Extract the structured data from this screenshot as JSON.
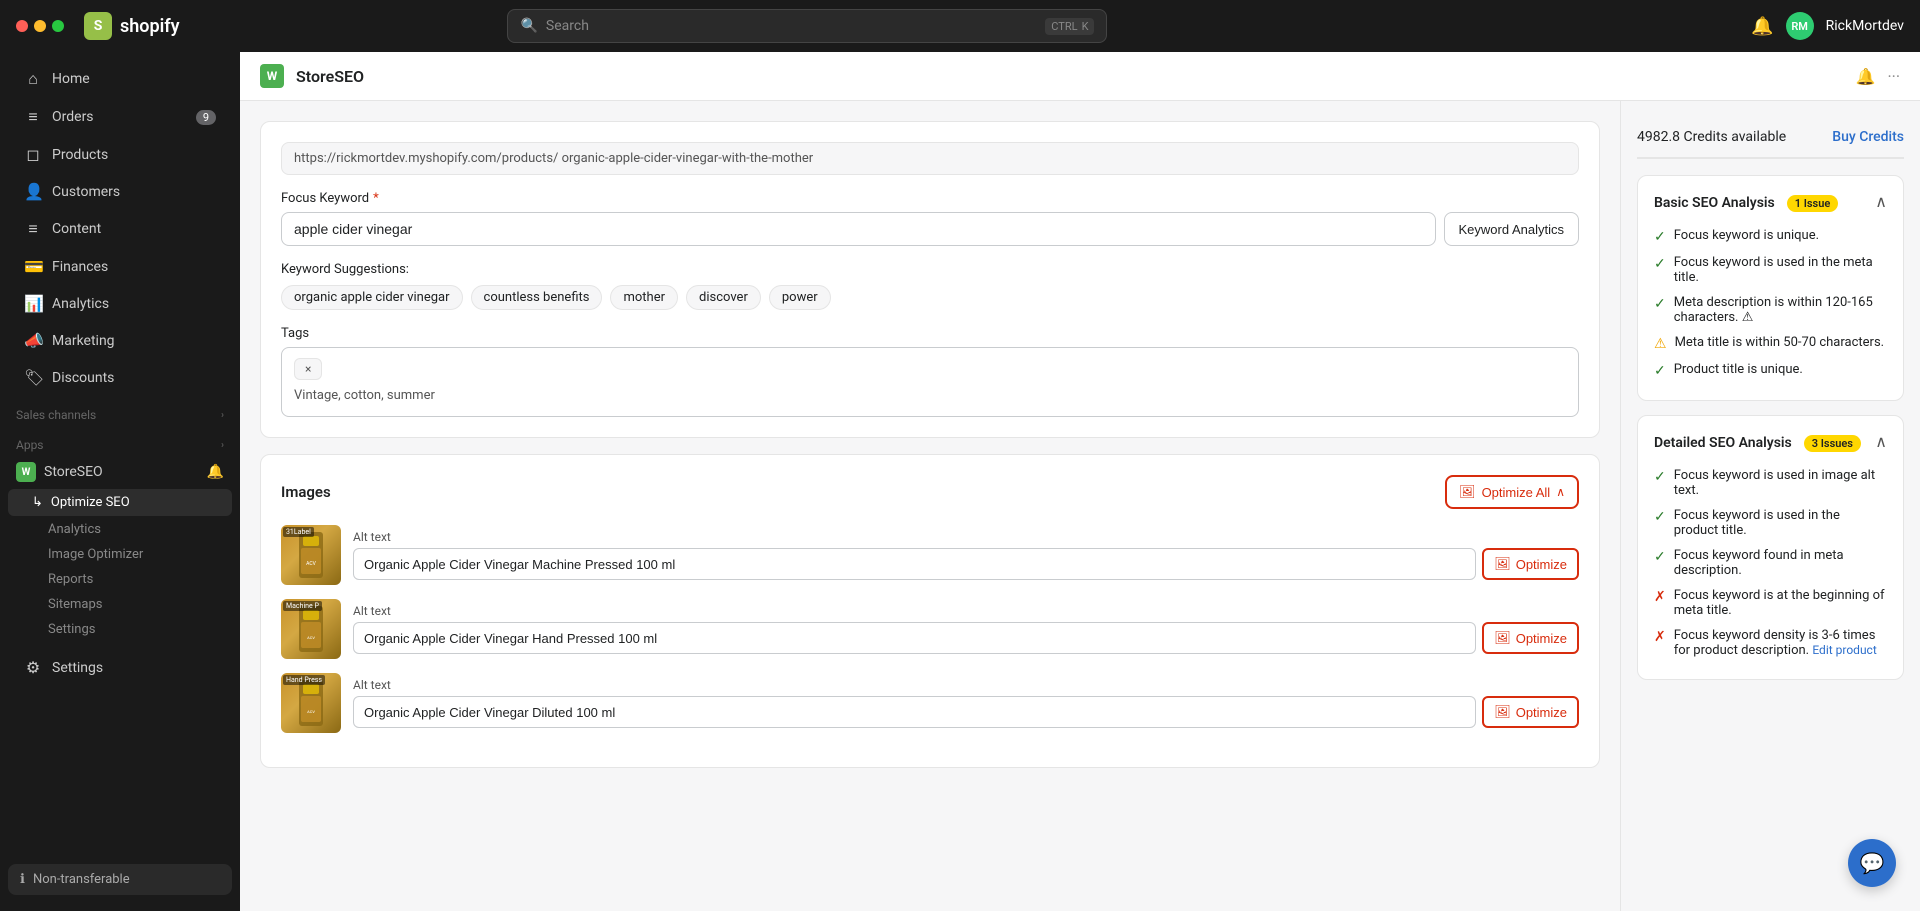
{
  "window": {
    "traffic_lights": [
      "red",
      "yellow",
      "green"
    ]
  },
  "topbar": {
    "brand": "shopify",
    "search_placeholder": "Search",
    "shortcut_ctrl": "CTRL",
    "shortcut_key": "K",
    "username": "RickMortdev"
  },
  "sidebar": {
    "items": [
      {
        "id": "home",
        "label": "Home",
        "icon": "⌂",
        "badge": null
      },
      {
        "id": "orders",
        "label": "Orders",
        "icon": "☰",
        "badge": "9"
      },
      {
        "id": "products",
        "label": "Products",
        "icon": "◫",
        "badge": null
      },
      {
        "id": "customers",
        "label": "Customers",
        "icon": "👤",
        "badge": null
      },
      {
        "id": "content",
        "label": "Content",
        "icon": "☰",
        "badge": null
      },
      {
        "id": "finances",
        "label": "Finances",
        "icon": "💰",
        "badge": null
      },
      {
        "id": "analytics",
        "label": "Analytics",
        "icon": "📊",
        "badge": null
      },
      {
        "id": "marketing",
        "label": "Marketing",
        "icon": "📣",
        "badge": null
      },
      {
        "id": "discounts",
        "label": "Discounts",
        "icon": "🏷",
        "badge": null
      }
    ],
    "sales_channels": "Sales channels",
    "apps_label": "Apps",
    "storeseo": {
      "label": "StoreSEO",
      "sub_items": [
        {
          "id": "optimize-seo",
          "label": "Optimize SEO",
          "active": true
        },
        {
          "id": "analytics-sub",
          "label": "Analytics"
        },
        {
          "id": "image-optimizer",
          "label": "Image Optimizer"
        },
        {
          "id": "reports",
          "label": "Reports"
        },
        {
          "id": "sitemaps",
          "label": "Sitemaps"
        },
        {
          "id": "settings-sub",
          "label": "Settings"
        }
      ]
    },
    "settings_label": "Settings",
    "non_transferable": "Non-transferable"
  },
  "app_header": {
    "title": "StoreSEO",
    "bell_icon": "🔔",
    "more_icon": "···"
  },
  "main": {
    "url_bar": "https://rickmortdev.myshopify.com/products/  organic-apple-cider-vinegar-with-the-mother",
    "focus_keyword": {
      "label": "Focus Keyword",
      "value": "apple cider vinegar",
      "keyword_analytics_btn": "Keyword Analytics"
    },
    "suggestions": {
      "label": "Keyword Suggestions:",
      "tags": [
        "organic apple cider vinegar",
        "countless benefits",
        "mother",
        "discover",
        "power"
      ]
    },
    "tags": {
      "label": "Tags",
      "tag_chip": "×",
      "tag_value": "Vintage, cotton, summer"
    },
    "images": {
      "title": "Images",
      "optimize_all_btn": "Optimize All",
      "rows": [
        {
          "alt_label": "Alt text",
          "alt_value": "Organic Apple Cider Vinegar Machine Pressed 100 ml",
          "thumb_label": "31Label",
          "optimize_btn": "Optimize"
        },
        {
          "alt_label": "Alt text",
          "alt_value": "Organic Apple Cider Vinegar Hand Pressed 100 ml",
          "thumb_label": "Machine P",
          "optimize_btn": "Optimize"
        },
        {
          "alt_label": "Alt text",
          "alt_value": "Organic Apple Cider Vinegar Diluted 100 ml",
          "thumb_label": "Hand Press",
          "optimize_btn": "Optimize"
        }
      ]
    }
  },
  "right_panel": {
    "credits": {
      "available": "4982.8 Credits available",
      "buy_btn": "Buy Credits"
    },
    "basic_seo": {
      "title": "Basic SEO Analysis",
      "badge": "1 Issue",
      "items": [
        {
          "status": "check",
          "text": "Focus keyword is unique."
        },
        {
          "status": "check",
          "text": "Focus keyword is used in the meta title."
        },
        {
          "status": "check",
          "text": "Meta description is within 120-165 characters. ⚠"
        },
        {
          "status": "warn",
          "text": "Meta title is within 50-70 characters."
        },
        {
          "status": "check",
          "text": "Product title is unique."
        }
      ]
    },
    "detailed_seo": {
      "title": "Detailed SEO Analysis",
      "badge": "3 Issues",
      "items": [
        {
          "status": "check",
          "text": "Focus keyword is used in image alt text."
        },
        {
          "status": "check",
          "text": "Focus keyword is used in the product title."
        },
        {
          "status": "check",
          "text": "Focus keyword found in meta description."
        },
        {
          "status": "cross",
          "text": "Focus keyword is at the beginning of meta title."
        },
        {
          "status": "cross",
          "text": "Focus keyword density is 3-6 times for product description.",
          "link": "Edit product"
        }
      ]
    }
  },
  "chat_btn": "💬"
}
